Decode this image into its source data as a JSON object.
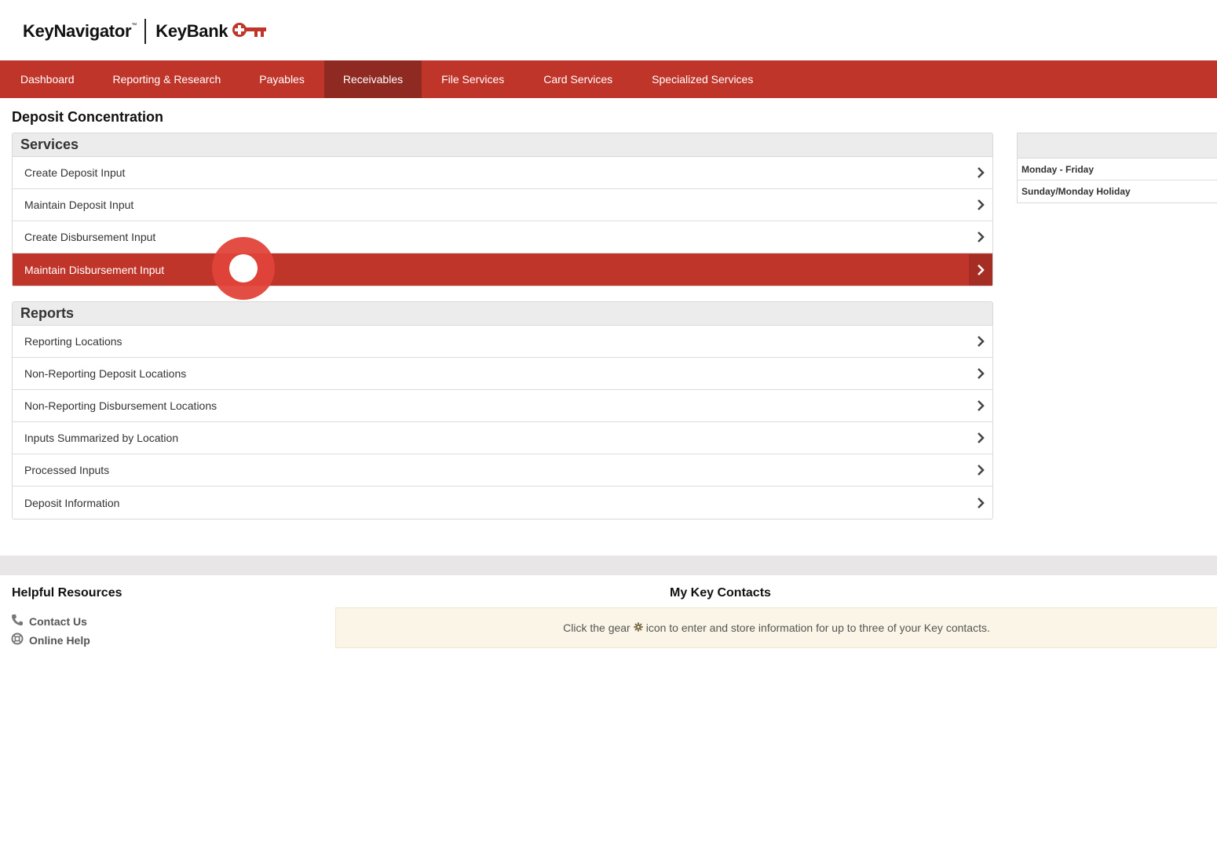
{
  "brand": {
    "product": "KeyNavigator",
    "trademark": "™",
    "bank": "KeyBank",
    "accent_color": "#c0352a"
  },
  "nav": {
    "items": [
      {
        "label": "Dashboard"
      },
      {
        "label": "Reporting & Research"
      },
      {
        "label": "Payables"
      },
      {
        "label": "Receivables"
      },
      {
        "label": "File Services"
      },
      {
        "label": "Card Services"
      },
      {
        "label": "Specialized Services"
      }
    ],
    "active": "Receivables"
  },
  "page": {
    "title": "Deposit Concentration"
  },
  "services": {
    "heading": "Services",
    "items": [
      {
        "label": "Create Deposit Input"
      },
      {
        "label": "Maintain Deposit Input"
      },
      {
        "label": "Create Disbursement Input"
      },
      {
        "label": "Maintain Disbursement Input"
      }
    ],
    "selected": "Maintain Disbursement Input"
  },
  "reports": {
    "heading": "Reports",
    "items": [
      {
        "label": "Reporting Locations"
      },
      {
        "label": "Non-Reporting Deposit Locations"
      },
      {
        "label": "Non-Reporting Disbursement Locations"
      },
      {
        "label": "Inputs Summarized by Location"
      },
      {
        "label": "Processed Inputs"
      },
      {
        "label": "Deposit Information"
      }
    ]
  },
  "schedule": {
    "rows": [
      {
        "label": "Monday - Friday"
      },
      {
        "label": "Sunday/Monday Holiday"
      }
    ]
  },
  "footer": {
    "helpful_title": "Helpful Resources",
    "contact_us": "Contact Us",
    "online_help": "Online Help",
    "contacts_title": "My Key Contacts",
    "contacts_msg_before": "Click the gear",
    "contacts_msg_after": "icon to enter and store information for up to three of your Key contacts."
  },
  "icons": {
    "chevron": "chevron-right-icon",
    "phone": "phone-icon",
    "help": "lifebuoy-icon",
    "gear": "gear-icon",
    "logo_key": "key-icon"
  }
}
